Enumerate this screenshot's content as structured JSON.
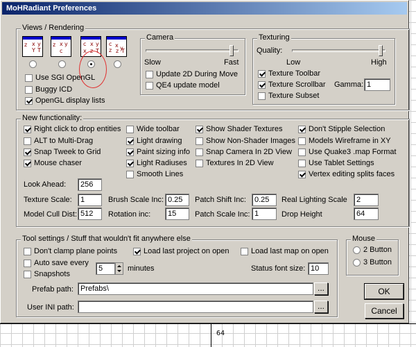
{
  "window": {
    "title": "MoHRadiant Preferences"
  },
  "background": {
    "grid_label": "64"
  },
  "views": {
    "legend": "Views / Rendering",
    "selected_index": 2,
    "icons": [
      "view-layout-1-icon",
      "view-layout-2-icon",
      "view-layout-3-icon",
      "view-layout-4-icon"
    ],
    "checkboxes": [
      {
        "label": "Use SGI OpenGL",
        "checked": false
      },
      {
        "label": "Buggy ICD",
        "checked": false
      },
      {
        "label": "OpenGL display lists",
        "checked": true
      }
    ]
  },
  "camera": {
    "legend": "Camera",
    "slow_label": "Slow",
    "fast_label": "Fast",
    "slider_value": 1.0,
    "checkboxes": [
      {
        "label": "Update 2D During Move",
        "checked": false
      },
      {
        "label": "QE4 update model",
        "checked": false
      }
    ]
  },
  "texturing": {
    "legend": "Texturing",
    "quality_label": "Quality:",
    "low_label": "Low",
    "high_label": "High",
    "slider_value": 1.0,
    "checkboxes": [
      {
        "label": "Texture Toolbar",
        "checked": true
      },
      {
        "label": "Texture Scrollbar",
        "checked": true
      },
      {
        "label": "Texture Subset",
        "checked": false
      }
    ],
    "gamma_label": "Gamma:",
    "gamma_value": "1"
  },
  "newfunc": {
    "legend": "New functionality:",
    "col1": [
      {
        "label": "Right click to drop entities",
        "checked": true
      },
      {
        "label": "ALT to Multi-Drag",
        "checked": false
      },
      {
        "label": "Snap Tweek to Grid",
        "checked": true
      },
      {
        "label": "Mouse chaser",
        "checked": true
      }
    ],
    "col2": [
      {
        "label": "Wide toolbar",
        "checked": false
      },
      {
        "label": "Light drawing",
        "checked": true
      },
      {
        "label": "Paint sizing info",
        "checked": true
      },
      {
        "label": "Light Radiuses",
        "checked": true
      },
      {
        "label": "Smooth Lines",
        "checked": false
      }
    ],
    "col3": [
      {
        "label": "Show Shader Textures",
        "checked": true
      },
      {
        "label": "Show Non-Shader Images",
        "checked": false
      },
      {
        "label": "Snap Camera In 2D View",
        "checked": false
      },
      {
        "label": "Textures In 2D View",
        "checked": false
      }
    ],
    "col4": [
      {
        "label": "Don't Stipple Selection",
        "checked": true
      },
      {
        "label": "Models Wireframe in XY",
        "checked": false
      },
      {
        "label": "Use Quake3 .map Format",
        "checked": false
      },
      {
        "label": "Use Tablet Settings",
        "checked": false
      },
      {
        "label": "Vertex editing splits faces",
        "checked": true
      }
    ],
    "look_ahead_label": "Look Ahead:",
    "look_ahead_value": "256",
    "texture_scale_label": "Texture Scale:",
    "texture_scale_value": "1",
    "brush_scale_label": "Brush Scale Inc:",
    "brush_scale_value": "0.25",
    "patch_shift_label": "Patch Shift Inc:",
    "patch_shift_value": "0.25",
    "real_light_label": "Real Lighting Scale",
    "real_light_value": "2",
    "model_cull_label": "Model Cull Dist:",
    "model_cull_value": "512",
    "rotation_label": "Rotation inc:",
    "rotation_value": "15",
    "patch_scale_label": "Patch Scale Inc:",
    "patch_scale_value": "1",
    "drop_height_label": "Drop Height",
    "drop_height_value": "64"
  },
  "tools": {
    "legend": "Tool settings / Stuff that wouldn't fit anywhere else",
    "dont_clamp": {
      "label": "Don't clamp plane points",
      "checked": false
    },
    "load_project": {
      "label": "Load last project on open",
      "checked": true
    },
    "load_map": {
      "label": "Load last map on open",
      "checked": false
    },
    "auto_save": {
      "label": "Auto save every",
      "checked": false
    },
    "snapshots": {
      "label": "Snapshots",
      "checked": false
    },
    "autosave_value": "5",
    "minutes_label": "minutes",
    "status_font_label": "Status font size:",
    "status_font_value": "10",
    "prefab_label": "Prefab path:",
    "prefab_value": "Prefabs\\",
    "user_ini_label": "User INI path:",
    "user_ini_value": "",
    "browse_label": "..."
  },
  "mouse": {
    "legend": "Mouse",
    "options": [
      {
        "label": "2 Button",
        "selected": false
      },
      {
        "label": "3 Button",
        "selected": false
      }
    ]
  },
  "buttons": {
    "ok": "OK",
    "cancel": "Cancel"
  }
}
